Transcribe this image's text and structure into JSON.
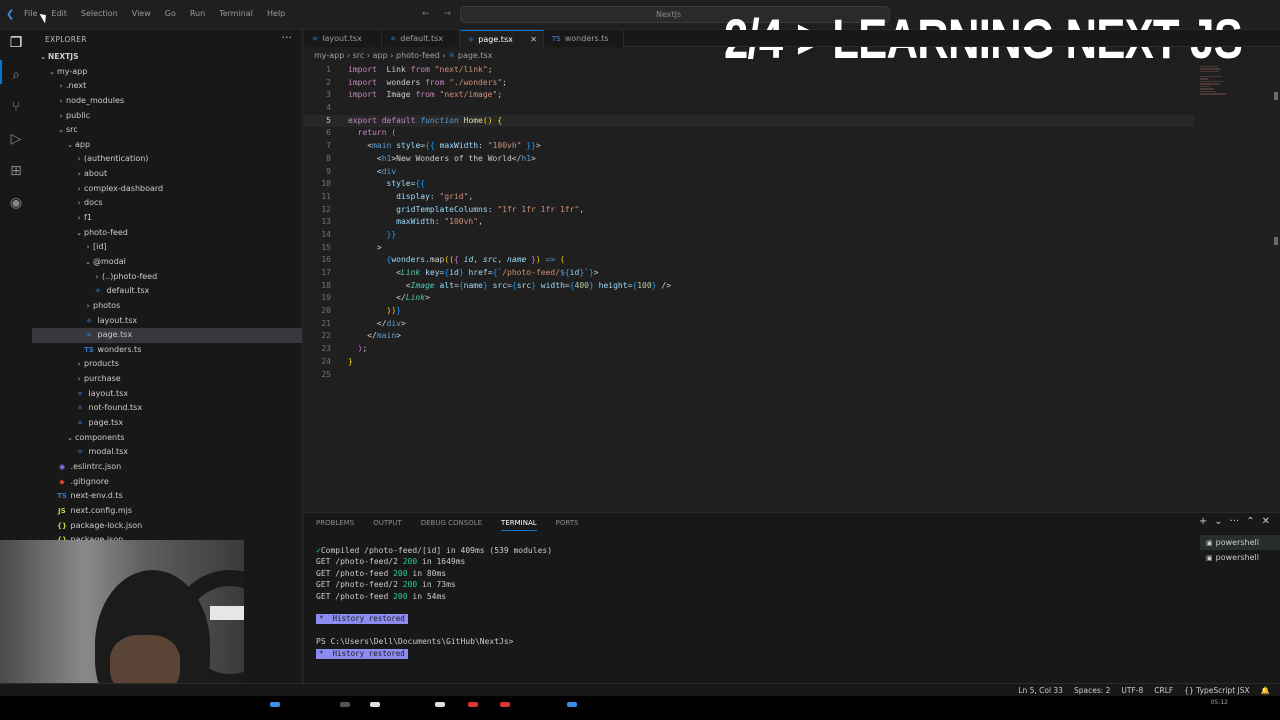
{
  "title_menu": [
    "File",
    "Edit",
    "Selection",
    "View",
    "Go",
    "Run",
    "Terminal",
    "Help"
  ],
  "command_center": "NextJs",
  "banner": "2/4-> LEARNING NEXT JS",
  "sidebar": {
    "header": "EXPLORER",
    "more": "···",
    "tree": [
      {
        "indent": 0,
        "chev": "⌄",
        "label": "NEXTJS",
        "root": true
      },
      {
        "indent": 1,
        "chev": "⌄",
        "label": "my-app"
      },
      {
        "indent": 2,
        "chev": "›",
        "label": ".next"
      },
      {
        "indent": 2,
        "chev": "›",
        "label": "node_modules"
      },
      {
        "indent": 2,
        "chev": "›",
        "label": "public"
      },
      {
        "indent": 2,
        "chev": "⌄",
        "label": "src"
      },
      {
        "indent": 3,
        "chev": "⌄",
        "label": "app"
      },
      {
        "indent": 4,
        "chev": "›",
        "label": "(authentication)"
      },
      {
        "indent": 4,
        "chev": "›",
        "label": "about"
      },
      {
        "indent": 4,
        "chev": "›",
        "label": "complex-dashboard"
      },
      {
        "indent": 4,
        "chev": "›",
        "label": "docs"
      },
      {
        "indent": 4,
        "chev": "›",
        "label": "f1"
      },
      {
        "indent": 4,
        "chev": "⌄",
        "label": "photo-feed"
      },
      {
        "indent": 5,
        "chev": "›",
        "label": "[id]"
      },
      {
        "indent": 5,
        "chev": "⌄",
        "label": "@modal"
      },
      {
        "indent": 6,
        "chev": "›",
        "label": "(..)photo-feed"
      },
      {
        "indent": 6,
        "icon": "react",
        "label": "default.tsx"
      },
      {
        "indent": 5,
        "chev": "›",
        "label": "photos"
      },
      {
        "indent": 5,
        "icon": "react",
        "label": "layout.tsx"
      },
      {
        "indent": 5,
        "icon": "react",
        "label": "page.tsx",
        "selected": true
      },
      {
        "indent": 5,
        "icon": "ts",
        "label": "wonders.ts"
      },
      {
        "indent": 4,
        "chev": "›",
        "label": "products"
      },
      {
        "indent": 4,
        "chev": "›",
        "label": "purchase"
      },
      {
        "indent": 4,
        "icon": "react",
        "label": "layout.tsx"
      },
      {
        "indent": 4,
        "icon": "react",
        "label": "not-found.tsx"
      },
      {
        "indent": 4,
        "icon": "react",
        "label": "page.tsx"
      },
      {
        "indent": 3,
        "chev": "⌄",
        "label": "components"
      },
      {
        "indent": 4,
        "icon": "react",
        "label": "modal.tsx"
      },
      {
        "indent": 2,
        "icon": "eslint",
        "label": ".eslintrc.json"
      },
      {
        "indent": 2,
        "icon": "git",
        "label": ".gitignore"
      },
      {
        "indent": 2,
        "icon": "ts",
        "label": "next-env.d.ts"
      },
      {
        "indent": 2,
        "icon": "js",
        "label": "next.config.mjs"
      },
      {
        "indent": 2,
        "icon": "json",
        "label": "package-lock.json"
      },
      {
        "indent": 2,
        "icon": "json",
        "label": "package.json"
      }
    ]
  },
  "tabs": [
    {
      "label": "layout.tsx",
      "icon": "react"
    },
    {
      "label": "default.tsx",
      "icon": "react"
    },
    {
      "label": "page.tsx",
      "icon": "react",
      "active": true
    },
    {
      "label": "wonders.ts",
      "icon": "ts"
    }
  ],
  "breadcrumb": [
    "my-app",
    "src",
    "app",
    "photo-feed",
    "page.tsx"
  ],
  "editor": {
    "current_line": 5,
    "lines": [
      [
        [
          "kw",
          "import"
        ],
        [
          "",
          "  Link "
        ],
        [
          "kw",
          "from"
        ],
        [
          "str",
          " \"next/link\""
        ],
        [
          "",
          ";"
        ]
      ],
      [
        [
          "kw",
          "import"
        ],
        [
          "",
          "  wonders "
        ],
        [
          "kw",
          "from"
        ],
        [
          "str",
          " \"./wonders\""
        ],
        [
          "",
          ";"
        ]
      ],
      [
        [
          "kw",
          "import"
        ],
        [
          "",
          "  Image "
        ],
        [
          "kw",
          "from"
        ],
        [
          "str",
          " \"next/image\""
        ],
        [
          "",
          ";"
        ]
      ],
      [],
      [
        [
          "kw",
          "export"
        ],
        [
          "",
          " "
        ],
        [
          "kw",
          "default"
        ],
        [
          "",
          " "
        ],
        [
          "kw2",
          "function"
        ],
        [
          "",
          " "
        ],
        [
          "fn",
          "Home"
        ],
        [
          "br1",
          "()"
        ],
        [
          "",
          " "
        ],
        [
          "br1",
          "{"
        ]
      ],
      [
        [
          "",
          ""
        ],
        [
          "kw",
          "  return"
        ],
        [
          "",
          " "
        ],
        [
          "br2",
          "("
        ]
      ],
      [
        [
          "",
          "    <"
        ],
        [
          "tag",
          "main"
        ],
        [
          "",
          " "
        ],
        [
          "var",
          "style"
        ],
        [
          "",
          "="
        ],
        [
          "br3",
          "{{"
        ],
        [
          "var",
          " maxWidth"
        ],
        [
          "",
          ": "
        ],
        [
          "str",
          "\"100vh\""
        ],
        [
          "br3",
          " }}"
        ],
        [
          "",
          ">"
        ]
      ],
      [
        [
          "",
          "      <"
        ],
        [
          "tag",
          "h1"
        ],
        [
          "",
          ">New Wonders of the World</"
        ],
        [
          "tag",
          "h1"
        ],
        [
          "",
          ">"
        ]
      ],
      [
        [
          "",
          "      <"
        ],
        [
          "tag",
          "div"
        ]
      ],
      [
        [
          "",
          "        "
        ],
        [
          "var",
          "style"
        ],
        [
          "",
          "="
        ],
        [
          "br3",
          "{{"
        ]
      ],
      [
        [
          "",
          "          "
        ],
        [
          "var",
          "display"
        ],
        [
          "",
          ": "
        ],
        [
          "str",
          "\"grid\""
        ],
        [
          "",
          ","
        ]
      ],
      [
        [
          "",
          "          "
        ],
        [
          "var",
          "gridTemplateColumns"
        ],
        [
          "",
          ": "
        ],
        [
          "str",
          "\"1fr 1fr 1fr 1fr\""
        ],
        [
          "",
          ","
        ]
      ],
      [
        [
          "",
          "          "
        ],
        [
          "var",
          "maxWidth"
        ],
        [
          "",
          ": "
        ],
        [
          "str",
          "\"100vh\""
        ],
        [
          "",
          ","
        ]
      ],
      [
        [
          "",
          "        "
        ],
        [
          "br3",
          "}}"
        ]
      ],
      [
        [
          "",
          "      >"
        ]
      ],
      [
        [
          "",
          "        "
        ],
        [
          "br3",
          "{"
        ],
        [
          "var",
          "wonders"
        ],
        [
          "",
          ".map"
        ],
        [
          "br1",
          "(("
        ],
        [
          "br2",
          "{ "
        ],
        [
          "var",
          "id"
        ],
        [
          "",
          ", "
        ],
        [
          "var",
          "src"
        ],
        [
          "",
          ", "
        ],
        [
          "var",
          "name"
        ],
        [
          "br2",
          " }"
        ],
        [
          "br1",
          ")"
        ],
        [
          "kw2",
          " =>"
        ],
        [
          "br1",
          " ("
        ]
      ],
      [
        [
          "",
          "          <"
        ],
        [
          "cmp",
          "Link"
        ],
        [
          "",
          " "
        ],
        [
          "var",
          "key"
        ],
        [
          "",
          "="
        ],
        [
          "br3",
          "{"
        ],
        [
          "var",
          "id"
        ],
        [
          "br3",
          "}"
        ],
        [
          "",
          " "
        ],
        [
          "var",
          "href"
        ],
        [
          "",
          "="
        ],
        [
          "br3",
          "{"
        ],
        [
          "str",
          "`/photo-feed/"
        ],
        [
          "kw2",
          "${"
        ],
        [
          "var",
          "id"
        ],
        [
          "kw2",
          "}"
        ],
        [
          "str",
          "`"
        ],
        [
          "br3",
          "}"
        ],
        [
          "",
          ">"
        ]
      ],
      [
        [
          "",
          "            <"
        ],
        [
          "cmp",
          "Image"
        ],
        [
          "",
          " "
        ],
        [
          "var",
          "alt"
        ],
        [
          "",
          "="
        ],
        [
          "br3",
          "{"
        ],
        [
          "var",
          "name"
        ],
        [
          "br3",
          "}"
        ],
        [
          "",
          " "
        ],
        [
          "var",
          "src"
        ],
        [
          "",
          "="
        ],
        [
          "br3",
          "{"
        ],
        [
          "var",
          "src"
        ],
        [
          "br3",
          "}"
        ],
        [
          "",
          " "
        ],
        [
          "var",
          "width"
        ],
        [
          "",
          "="
        ],
        [
          "br3",
          "{"
        ],
        [
          "num",
          "400"
        ],
        [
          "br3",
          "}"
        ],
        [
          "",
          " "
        ],
        [
          "var",
          "height"
        ],
        [
          "",
          "="
        ],
        [
          "br3",
          "{"
        ],
        [
          "num",
          "100"
        ],
        [
          "br3",
          "}"
        ],
        [
          "",
          " />"
        ]
      ],
      [
        [
          "",
          "          </"
        ],
        [
          "cmp",
          "Link"
        ],
        [
          "",
          ">"
        ]
      ],
      [
        [
          "",
          "        "
        ],
        [
          "br1",
          "))"
        ],
        [
          "br3",
          "}"
        ]
      ],
      [
        [
          "",
          "      </"
        ],
        [
          "tag",
          "div"
        ],
        [
          "",
          ">"
        ]
      ],
      [
        [
          "",
          "    </"
        ],
        [
          "tag",
          "main"
        ],
        [
          "",
          ">"
        ]
      ],
      [
        [
          "",
          "  "
        ],
        [
          "br2",
          ")"
        ],
        [
          "",
          ";"
        ]
      ],
      [
        [
          "br1",
          "}"
        ]
      ],
      []
    ]
  },
  "panel": {
    "tabs": [
      "PROBLEMS",
      "OUTPUT",
      "DEBUG CONSOLE",
      "TERMINAL",
      "PORTS"
    ],
    "active_tab": "TERMINAL",
    "actions": [
      "+",
      "⌄",
      "···",
      "⌃",
      "✕"
    ],
    "terminal": [
      {
        "type": "ok",
        "check": "✓",
        "text": "Compiled /photo-feed/[id] in 409ms (539 modules)"
      },
      {
        "type": "get",
        "method": "GET",
        "path": "/photo-feed/2",
        "code": "200",
        "rest": "in 1649ms"
      },
      {
        "type": "get",
        "method": "GET",
        "path": "/photo-feed",
        "code": "200",
        "rest": "in 80ms"
      },
      {
        "type": "get",
        "method": "GET",
        "path": "/photo-feed/2",
        "code": "200",
        "rest": "in 73ms"
      },
      {
        "type": "get",
        "method": "GET",
        "path": "/photo-feed",
        "code": "200",
        "rest": "in 54ms"
      },
      {
        "type": "blank"
      },
      {
        "type": "hist",
        "text": "*  History restored"
      },
      {
        "type": "blank"
      },
      {
        "type": "text",
        "text": "PS C:\\Users\\Dell\\Documents\\GitHub\\NextJs>"
      },
      {
        "type": "hist",
        "text": "*  History restored"
      }
    ],
    "shells": [
      "powershell",
      "powershell"
    ]
  },
  "statusbar": [
    "Ln 5, Col 33",
    "Spaces: 2",
    "UTF-8",
    "CRLF",
    "{} TypeScript JSX",
    "🔔"
  ],
  "clock": "05:12"
}
